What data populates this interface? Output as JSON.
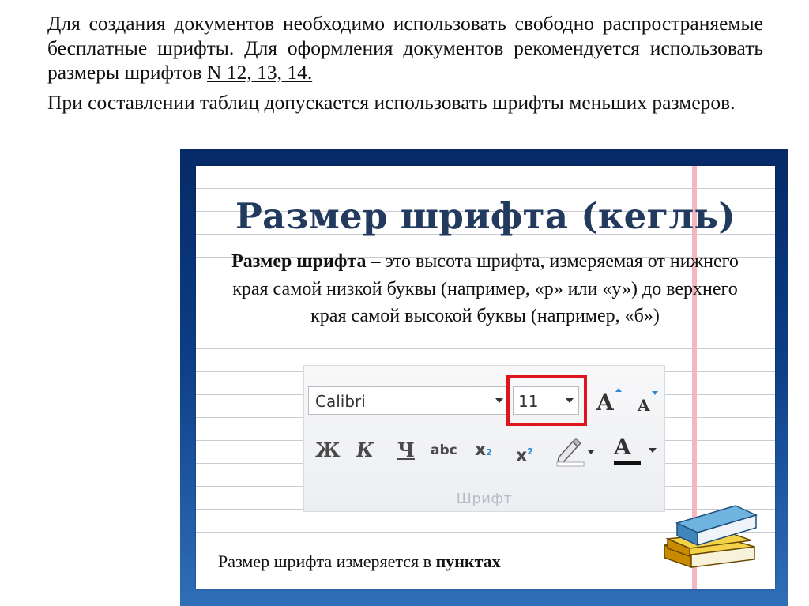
{
  "intro": {
    "p1_text": "Для создания документов необходимо использовать свободно распространяемые бесплатные шрифты. Для оформления документов рекомендуется использовать размеры шрифтов ",
    "p1_sizes": "N 12, 13, 14.",
    "p2_text": "При составлении таблиц допускается использовать шрифты меньших размеров."
  },
  "slide": {
    "title": "Размер шрифта (кегль)",
    "definition_term": "Размер шрифта –",
    "definition_text": " это высота шрифта, измеряемая от нижнего края самой низкой буквы (например, «р» или «у») до верхнего края самой высокой буквы (например, «б»)",
    "footer_text": "Размер шрифта измеряется в ",
    "footer_bold": "пунктах"
  },
  "ribbon": {
    "font_name": "Calibri",
    "font_size": "11",
    "grow_label": "A",
    "shrink_label": "A",
    "bold_label": "Ж",
    "italic_label": "К",
    "underline_label": "Ч",
    "strike_label": "abc",
    "subscript_label": "x",
    "subscript_small": "2",
    "superscript_label": "x",
    "superscript_small": "2",
    "font_color_label": "A",
    "group_label": "Шрифт"
  },
  "colors": {
    "slide_background": "#0c3d86",
    "title": "#223a5e",
    "highlight_frame": "#e0141c",
    "margin_line": "#f4b7c0"
  }
}
